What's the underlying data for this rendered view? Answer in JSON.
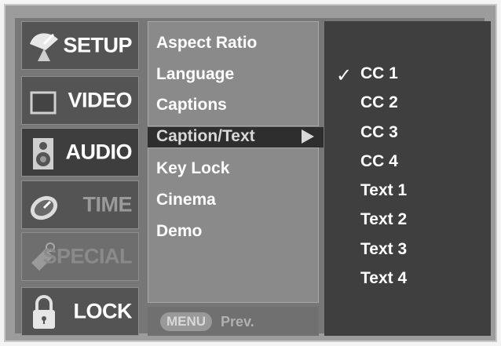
{
  "categories": [
    {
      "label": "SETUP",
      "icon": "satellite-dish-icon",
      "state": "normal"
    },
    {
      "label": "VIDEO",
      "icon": "screen-icon",
      "state": "normal"
    },
    {
      "label": "AUDIO",
      "icon": "speaker-icon",
      "state": "normal"
    },
    {
      "label": "TIME",
      "icon": "clock-icon",
      "state": "normal"
    },
    {
      "label": "SPECIAL",
      "icon": "special-icon",
      "state": "dim"
    },
    {
      "label": "LOCK",
      "icon": "padlock-icon",
      "state": "normal"
    }
  ],
  "submenu": {
    "items": [
      "Aspect Ratio",
      "Language",
      "Captions",
      "Caption/Text",
      "Key Lock",
      "Cinema",
      "Demo"
    ],
    "selected_index": 3
  },
  "footer": {
    "menu_button": "MENU",
    "prev_label": "Prev."
  },
  "options": {
    "items": [
      "CC 1",
      "CC 2",
      "CC 3",
      "CC 4",
      "Text 1",
      "Text 2",
      "Text 3",
      "Text 4"
    ],
    "checked_index": 0,
    "check_mark": "✓"
  },
  "colors": {
    "background": "#9c9c9c",
    "highlight": "#2e2e2e",
    "options_panel": "#3f3f3f"
  }
}
